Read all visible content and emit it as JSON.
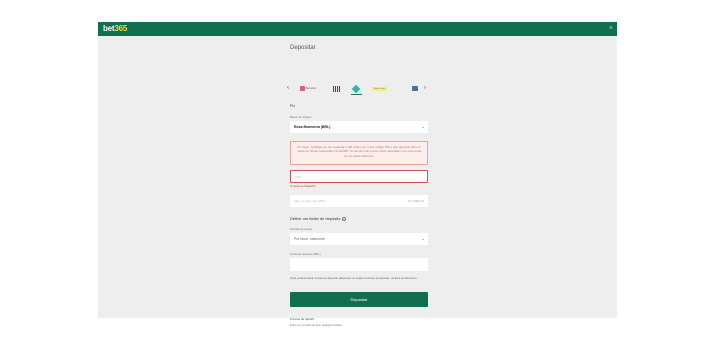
{
  "header": {
    "logo_main": "bet",
    "logo_accent": "365",
    "close_symbol": "×"
  },
  "page": {
    "title": "Depositar"
  },
  "methods": {
    "prev": "‹",
    "next": "›",
    "items": [
      {
        "name": "Skrill",
        "label": "Bet.nomo"
      },
      {
        "name": "Boleto",
        "label": ""
      },
      {
        "name": "Pix",
        "label": ""
      },
      {
        "name": "Transferencia",
        "label": "Banco Inter"
      },
      {
        "name": "Cartao",
        "label": ""
      }
    ]
  },
  "form": {
    "section_label": "Pix",
    "bank_label": "Banco de Origem",
    "bank_value": "Rosa Bramenra (BRL)",
    "alert_text": "Por favor, certifique-se de escanear o QR code com o seu código PIX e que deposite feito no modo do cliente cadastrado na bet365. No ato de criar a sua conta, depositar com uma conta de um titular diferente.",
    "cpf_placeholder": "CPF",
    "cpf_error": "O campo é obrigatório",
    "amount_placeholder": "Valor do Depósito (BRL)",
    "amount_minmax": "Min R$10,00",
    "limit_title": "Definir um limite de depósito",
    "period_label": "Período de tempo",
    "period_value": "Por favor, selecione",
    "limit_label": "Limite de depósito (BRL)",
    "note": "Você poderá definir limites de depósito adicionais na seção Controle de Apostas, na área de Membros.",
    "deposit_button": "Depositar",
    "help_link": "Precisa de Ajuda?",
    "help_text": "Entre em contato se tiver qualquer dúvida"
  }
}
